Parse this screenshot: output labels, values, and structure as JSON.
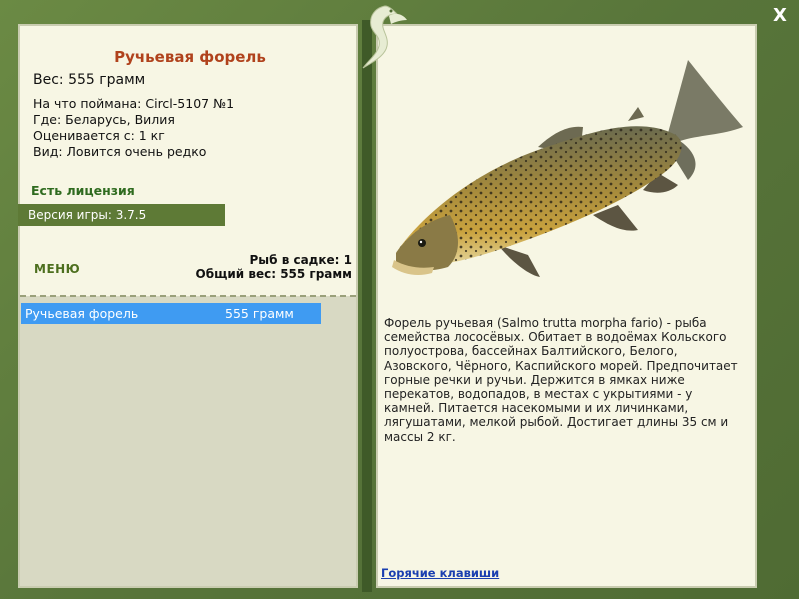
{
  "fish": {
    "name": "Ручьевая форель",
    "weight_line": "Вес: 555 грамм",
    "caught_on": "На что поймана: Circl-5107 №1",
    "where": "Где: Беларусь, Вилия",
    "valued_from": "Оценивается с: 1 кг",
    "rarity": "Вид: Ловится очень редко",
    "description": "Форель ручьевая (Salmo trutta morpha fario) - рыба семейства лососёвых. Обитает в водоёмах Кольского полуострова, бассейнах Балтийского, Белого, Азовского, Чёрного, Каспийского морей. Предпочитает горные речки и ручьи. Держится в ямках ниже перекатов, водопадов, в местах с укрытиями - у камней. Питается насекомыми и их личинками, лягушатами, мелкой рыбой. Достигает длины 35 см и массы 2 кг."
  },
  "license": "Есть лицензия",
  "version": "Версия игры: 3.7.5",
  "menu_label": "МЕНЮ",
  "keepnet": {
    "count": "Рыб в садке: 1",
    "total": "Общий вес: 555 грамм"
  },
  "catch_list": [
    {
      "name": "Ручьевая форель",
      "weight": "555 грамм"
    }
  ],
  "hotkeys": "Горячие клавиши",
  "close": "X",
  "icons": {
    "close": "close-icon",
    "logo": "fish-logo-icon"
  },
  "colors": {
    "title": "#b0421c",
    "license": "#2f6b1f",
    "selected": "#3f9bf2",
    "frame": "#5f7d3a"
  }
}
